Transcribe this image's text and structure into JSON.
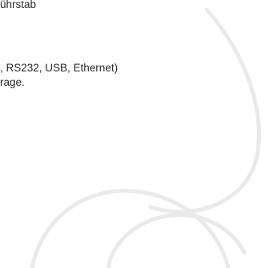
{
  "content": {
    "line_1": "ührstab",
    "line_2": ", RS232, USB, Ethernet)",
    "line_3": "rage."
  },
  "colors": {
    "text": "#2b2b2b",
    "background": "#ffffff",
    "watermark": "#eaeaea"
  }
}
